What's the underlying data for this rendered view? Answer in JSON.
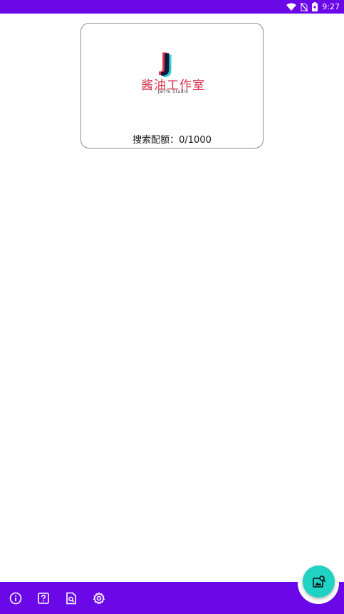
{
  "status_bar": {
    "time": "9:27",
    "icons": [
      "wifi-icon",
      "no-sim-icon",
      "battery-charging-icon"
    ]
  },
  "card": {
    "logo": {
      "letter": "J",
      "name_cn": "酱油工作室",
      "name_en": "JanYo Studio"
    },
    "quota_label": "搜索配额：0/1000"
  },
  "bottom_bar": {
    "items": [
      "info-icon",
      "help-icon",
      "document-search-icon",
      "settings-icon"
    ]
  },
  "fab": {
    "icon": "image-search-icon"
  },
  "colors": {
    "primary": "#6a08e8",
    "accent": "#1fd2c2",
    "logo_red": "#d8324c",
    "logo_navy": "#0d1b3c"
  }
}
